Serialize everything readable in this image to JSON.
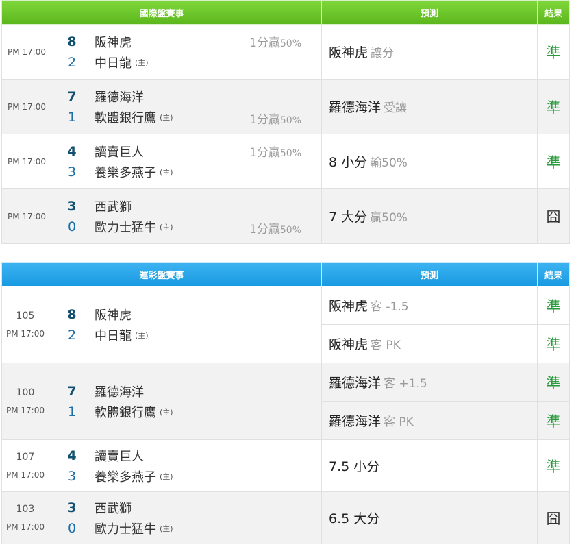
{
  "intl": {
    "header": {
      "match": "國際盤賽事",
      "prediction": "預測",
      "result": "結果"
    },
    "rows": [
      {
        "time": "PM 17:00",
        "away": {
          "score": "8",
          "name": "阪神虎"
        },
        "home": {
          "score": "2",
          "name": "中日龍",
          "tag": "(主)"
        },
        "handicap": {
          "text": "1分贏",
          "pct": "50%",
          "pos": "away"
        },
        "prediction": {
          "main": "阪神虎",
          "sub": "讓分"
        },
        "result": "準"
      },
      {
        "time": "PM 17:00",
        "away": {
          "score": "7",
          "name": "羅德海洋"
        },
        "home": {
          "score": "1",
          "name": "軟體銀行鷹",
          "tag": "(主)"
        },
        "handicap": {
          "text": "1分贏",
          "pct": "50%",
          "pos": "home"
        },
        "prediction": {
          "main": "羅德海洋",
          "sub": "受讓"
        },
        "result": "準"
      },
      {
        "time": "PM 17:00",
        "away": {
          "score": "4",
          "name": "讀賣巨人"
        },
        "home": {
          "score": "3",
          "name": "養樂多燕子",
          "tag": "(主)"
        },
        "handicap": {
          "text": "1分贏",
          "pct": "50%",
          "pos": "away"
        },
        "prediction": {
          "main": "8 小分",
          "sub": "輸50%"
        },
        "result": "準"
      },
      {
        "time": "PM 17:00",
        "away": {
          "score": "3",
          "name": "西武獅"
        },
        "home": {
          "score": "0",
          "name": "歐力士猛牛",
          "tag": "(主)"
        },
        "handicap": {
          "text": "1分贏",
          "pct": "50%",
          "pos": "home"
        },
        "prediction": {
          "main": "7 大分",
          "sub": "贏50%"
        },
        "result": "囧"
      }
    ]
  },
  "lottery": {
    "header": {
      "match": "運彩盤賽事",
      "prediction": "預測",
      "result": "結果"
    },
    "rows": [
      {
        "no": "105",
        "time": "PM 17:00",
        "away": {
          "score": "8",
          "name": "阪神虎"
        },
        "home": {
          "score": "2",
          "name": "中日龍",
          "tag": "(主)"
        },
        "predictions": [
          {
            "main": "阪神虎",
            "sub": "客 -1.5",
            "result": "準"
          },
          {
            "main": "阪神虎",
            "sub": "客 PK",
            "result": "準"
          }
        ]
      },
      {
        "no": "100",
        "time": "PM 17:00",
        "away": {
          "score": "7",
          "name": "羅德海洋"
        },
        "home": {
          "score": "1",
          "name": "軟體銀行鷹",
          "tag": "(主)"
        },
        "predictions": [
          {
            "main": "羅德海洋",
            "sub": "客 +1.5",
            "result": "準"
          },
          {
            "main": "羅德海洋",
            "sub": "客 PK",
            "result": "準"
          }
        ]
      },
      {
        "no": "107",
        "time": "PM 17:00",
        "away": {
          "score": "4",
          "name": "讀賣巨人"
        },
        "home": {
          "score": "3",
          "name": "養樂多燕子",
          "tag": "(主)"
        },
        "predictions": [
          {
            "main": "7.5 小分",
            "sub": "",
            "result": "準"
          }
        ]
      },
      {
        "no": "103",
        "time": "PM 17:00",
        "away": {
          "score": "3",
          "name": "西武獅"
        },
        "home": {
          "score": "0",
          "name": "歐力士猛牛",
          "tag": "(主)"
        },
        "predictions": [
          {
            "main": "6.5 大分",
            "sub": "",
            "result": "囧"
          }
        ]
      }
    ]
  },
  "colors": {
    "green_header": "#5bb61b",
    "blue_header": "#1899e0",
    "hit": "#2b9a3e",
    "score": "#1a6fa8"
  }
}
